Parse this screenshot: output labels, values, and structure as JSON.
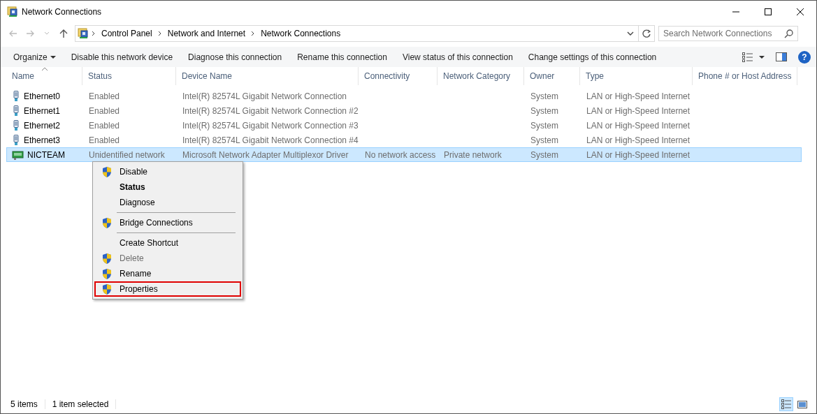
{
  "window": {
    "title": "Network Connections"
  },
  "address_bar": {
    "path": [
      "Control Panel",
      "Network and Internet",
      "Network Connections"
    ]
  },
  "search": {
    "placeholder": "Search Network Connections"
  },
  "help_button": {
    "label": "?"
  },
  "toolbar": {
    "items": [
      "Organize",
      "Disable this network device",
      "Diagnose this connection",
      "Rename this connection",
      "View status of this connection",
      "Change settings of this connection"
    ]
  },
  "table": {
    "columns": [
      "Name",
      "Status",
      "Device Name",
      "Connectivity",
      "Network Category",
      "Owner",
      "Type",
      "Phone # or Host Address"
    ],
    "rows": [
      {
        "kind": "ethernet",
        "selected": false,
        "cells": [
          "Ethernet0",
          "Enabled",
          "Intel(R) 82574L Gigabit Network Connection",
          "",
          "",
          "System",
          "LAN or High-Speed Internet",
          ""
        ]
      },
      {
        "kind": "ethernet",
        "selected": false,
        "cells": [
          "Ethernet1",
          "Enabled",
          "Intel(R) 82574L Gigabit Network Connection #2",
          "",
          "",
          "System",
          "LAN or High-Speed Internet",
          ""
        ]
      },
      {
        "kind": "ethernet",
        "selected": false,
        "cells": [
          "Ethernet2",
          "Enabled",
          "Intel(R) 82574L Gigabit Network Connection #3",
          "",
          "",
          "System",
          "LAN or High-Speed Internet",
          ""
        ]
      },
      {
        "kind": "ethernet",
        "selected": false,
        "cells": [
          "Ethernet3",
          "Enabled",
          "Intel(R) 82574L Gigabit Network Connection #4",
          "",
          "",
          "System",
          "LAN or High-Speed Internet",
          ""
        ]
      },
      {
        "kind": "team",
        "selected": true,
        "cells": [
          "NICTEAM",
          "Unidentified network",
          "Microsoft Network Adapter Multiplexor Driver",
          "No network access",
          "Private network",
          "System",
          "LAN or High-Speed Internet",
          ""
        ]
      }
    ]
  },
  "context_menu": {
    "items": [
      {
        "kind": "item",
        "label": "Disable",
        "shield": true,
        "bold": false,
        "disabled": false,
        "highlighted": false
      },
      {
        "kind": "item",
        "label": "Status",
        "shield": false,
        "bold": true,
        "disabled": false,
        "highlighted": false
      },
      {
        "kind": "item",
        "label": "Diagnose",
        "shield": false,
        "bold": false,
        "disabled": false,
        "highlighted": false
      },
      {
        "kind": "separator"
      },
      {
        "kind": "item",
        "label": "Bridge Connections",
        "shield": true,
        "bold": false,
        "disabled": false,
        "highlighted": false
      },
      {
        "kind": "separator"
      },
      {
        "kind": "item",
        "label": "Create Shortcut",
        "shield": false,
        "bold": false,
        "disabled": false,
        "highlighted": false
      },
      {
        "kind": "item",
        "label": "Delete",
        "shield": true,
        "bold": false,
        "disabled": true,
        "highlighted": false
      },
      {
        "kind": "item",
        "label": "Rename",
        "shield": true,
        "bold": false,
        "disabled": false,
        "highlighted": false
      },
      {
        "kind": "item",
        "label": "Properties",
        "shield": true,
        "bold": false,
        "disabled": false,
        "highlighted": true
      }
    ]
  },
  "status_bar": {
    "items": [
      "5 items",
      "1 item selected"
    ]
  }
}
